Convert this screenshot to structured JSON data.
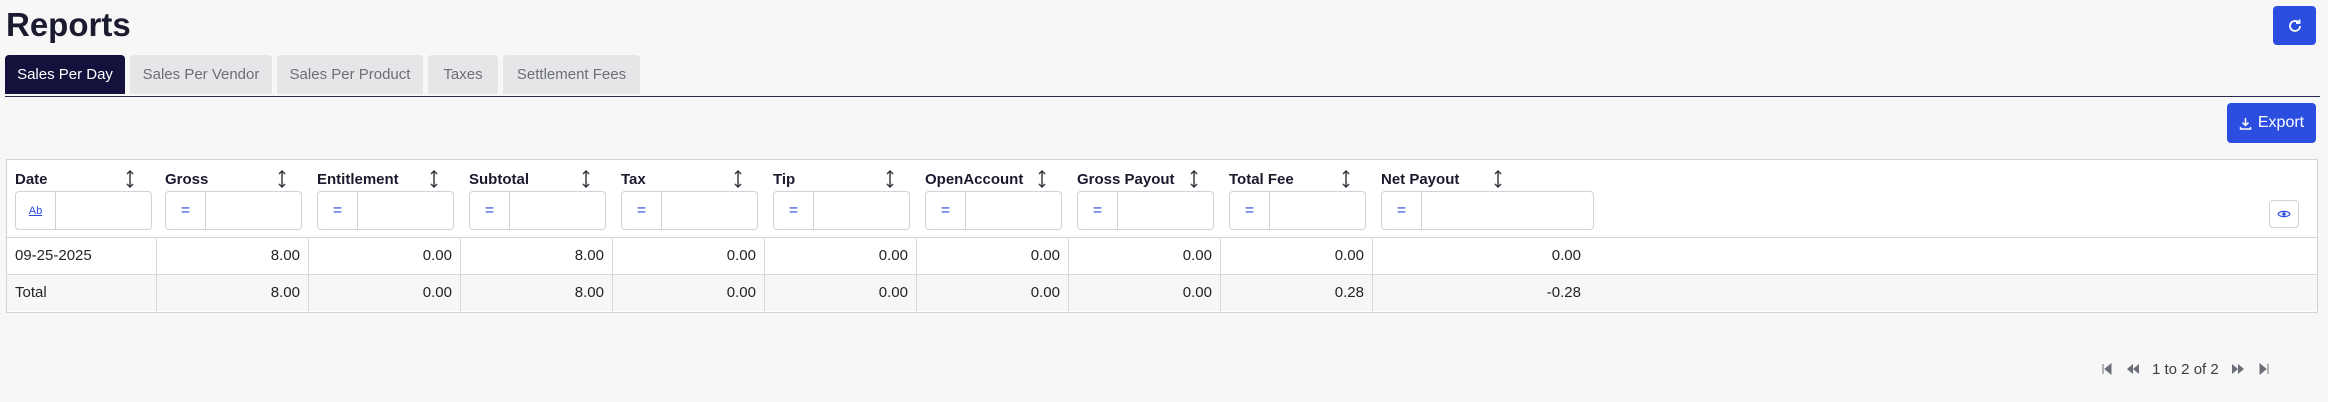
{
  "page": {
    "title": "Reports"
  },
  "tabs": [
    {
      "label": "Sales Per Day",
      "active": true
    },
    {
      "label": "Sales Per Vendor"
    },
    {
      "label": "Sales Per Product"
    },
    {
      "label": "Taxes"
    },
    {
      "label": "Settlement Fees"
    }
  ],
  "toolbar": {
    "export_label": "Export"
  },
  "table": {
    "columns": [
      {
        "label": "Date",
        "filter": "Ab"
      },
      {
        "label": "Gross",
        "filter": "="
      },
      {
        "label": "Entitlement",
        "filter": "="
      },
      {
        "label": "Subtotal",
        "filter": "="
      },
      {
        "label": "Tax",
        "filter": "="
      },
      {
        "label": "Tip",
        "filter": "="
      },
      {
        "label": "OpenAccount",
        "filter": "="
      },
      {
        "label": "Gross Payout",
        "filter": "="
      },
      {
        "label": "Total Fee",
        "filter": "="
      },
      {
        "label": "Net Payout",
        "filter": "="
      }
    ],
    "rows": [
      [
        "09-25-2025",
        "8.00",
        "0.00",
        "8.00",
        "0.00",
        "0.00",
        "0.00",
        "0.00",
        "0.00",
        "0.00"
      ],
      [
        "Total",
        "8.00",
        "0.00",
        "8.00",
        "0.00",
        "0.00",
        "0.00",
        "0.00",
        "0.28",
        "-0.28"
      ]
    ]
  },
  "pagination": {
    "summary": "1 to 2 of 2"
  },
  "colors": {
    "primary": "#2b4de0",
    "active_tab": "#14113c"
  }
}
